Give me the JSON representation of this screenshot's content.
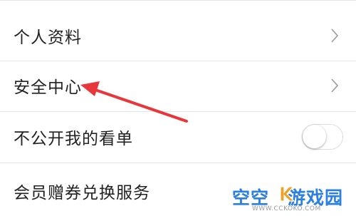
{
  "settings": {
    "items": [
      {
        "label": "个人资料",
        "control": "chevron"
      },
      {
        "label": "安全中心",
        "control": "chevron"
      },
      {
        "label": "不公开我的看单",
        "control": "toggle",
        "toggle_on": false
      },
      {
        "label": "会员赠券兑换服务",
        "control": "chevron"
      }
    ]
  },
  "watermark": {
    "brand_left": "空空",
    "brand_right": "游戏园",
    "url": "WWW.CCKOKO.COM"
  },
  "colors": {
    "annotation_arrow": "#e8363a",
    "watermark_blue": "#2a7fe0",
    "watermark_accent": "#f0a020"
  }
}
